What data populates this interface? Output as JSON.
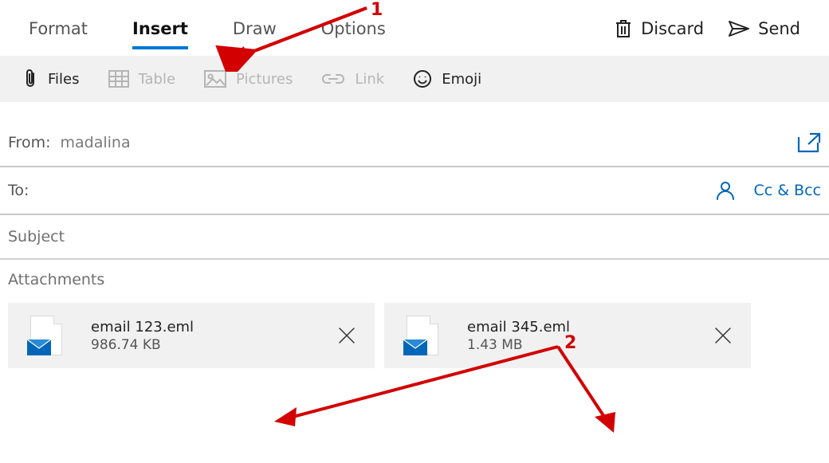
{
  "tabs": {
    "format": "Format",
    "insert": "Insert",
    "draw": "Draw",
    "options": "Options"
  },
  "actions": {
    "discard": "Discard",
    "send": "Send"
  },
  "toolbar": {
    "files": "Files",
    "table": "Table",
    "pictures": "Pictures",
    "link": "Link",
    "emoji": "Emoji"
  },
  "fields": {
    "from_label": "From:",
    "from_value": "madalina",
    "to_label": "To:",
    "ccbcc": "Cc & Bcc",
    "subject_placeholder": "Subject",
    "attachments_label": "Attachments"
  },
  "attachments": [
    {
      "name": "email 123.eml",
      "size": "986.74 KB"
    },
    {
      "name": "email 345.eml",
      "size": "1.43 MB"
    }
  ],
  "annotations": {
    "one": "1",
    "two": "2"
  }
}
